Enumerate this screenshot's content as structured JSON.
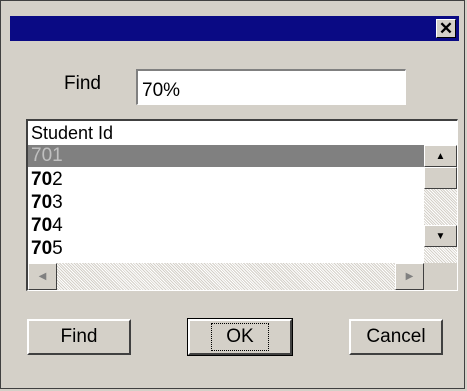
{
  "dialog": {
    "close_glyph": "✕",
    "find_label": "Find",
    "find_value": "70%",
    "list": {
      "header": "Student Id",
      "rows": [
        {
          "bold": "",
          "rest": "701",
          "selected": true
        },
        {
          "bold": "70",
          "rest": "2",
          "selected": false
        },
        {
          "bold": "70",
          "rest": "3",
          "selected": false
        },
        {
          "bold": "70",
          "rest": "4",
          "selected": false
        },
        {
          "bold": "70",
          "rest": "5",
          "selected": false
        }
      ]
    },
    "buttons": {
      "find": "Find",
      "ok": "OK",
      "cancel": "Cancel"
    },
    "colors": {
      "title_bar": "#0a0a84",
      "face": "#d4d0c8",
      "selection": "#808080"
    }
  }
}
